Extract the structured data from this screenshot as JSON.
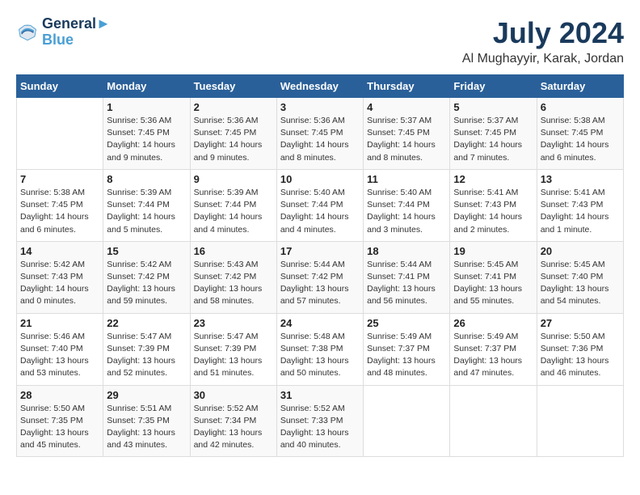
{
  "header": {
    "logo_line1": "General",
    "logo_line2": "Blue",
    "month": "July 2024",
    "location": "Al Mughayyir, Karak, Jordan"
  },
  "columns": [
    "Sunday",
    "Monday",
    "Tuesday",
    "Wednesday",
    "Thursday",
    "Friday",
    "Saturday"
  ],
  "weeks": [
    {
      "cells": [
        {
          "day": "",
          "info": ""
        },
        {
          "day": "1",
          "info": "Sunrise: 5:36 AM\nSunset: 7:45 PM\nDaylight: 14 hours\nand 9 minutes."
        },
        {
          "day": "2",
          "info": "Sunrise: 5:36 AM\nSunset: 7:45 PM\nDaylight: 14 hours\nand 9 minutes."
        },
        {
          "day": "3",
          "info": "Sunrise: 5:36 AM\nSunset: 7:45 PM\nDaylight: 14 hours\nand 8 minutes."
        },
        {
          "day": "4",
          "info": "Sunrise: 5:37 AM\nSunset: 7:45 PM\nDaylight: 14 hours\nand 8 minutes."
        },
        {
          "day": "5",
          "info": "Sunrise: 5:37 AM\nSunset: 7:45 PM\nDaylight: 14 hours\nand 7 minutes."
        },
        {
          "day": "6",
          "info": "Sunrise: 5:38 AM\nSunset: 7:45 PM\nDaylight: 14 hours\nand 6 minutes."
        }
      ]
    },
    {
      "cells": [
        {
          "day": "7",
          "info": "Sunrise: 5:38 AM\nSunset: 7:45 PM\nDaylight: 14 hours\nand 6 minutes."
        },
        {
          "day": "8",
          "info": "Sunrise: 5:39 AM\nSunset: 7:44 PM\nDaylight: 14 hours\nand 5 minutes."
        },
        {
          "day": "9",
          "info": "Sunrise: 5:39 AM\nSunset: 7:44 PM\nDaylight: 14 hours\nand 4 minutes."
        },
        {
          "day": "10",
          "info": "Sunrise: 5:40 AM\nSunset: 7:44 PM\nDaylight: 14 hours\nand 4 minutes."
        },
        {
          "day": "11",
          "info": "Sunrise: 5:40 AM\nSunset: 7:44 PM\nDaylight: 14 hours\nand 3 minutes."
        },
        {
          "day": "12",
          "info": "Sunrise: 5:41 AM\nSunset: 7:43 PM\nDaylight: 14 hours\nand 2 minutes."
        },
        {
          "day": "13",
          "info": "Sunrise: 5:41 AM\nSunset: 7:43 PM\nDaylight: 14 hours\nand 1 minute."
        }
      ]
    },
    {
      "cells": [
        {
          "day": "14",
          "info": "Sunrise: 5:42 AM\nSunset: 7:43 PM\nDaylight: 14 hours\nand 0 minutes."
        },
        {
          "day": "15",
          "info": "Sunrise: 5:42 AM\nSunset: 7:42 PM\nDaylight: 13 hours\nand 59 minutes."
        },
        {
          "day": "16",
          "info": "Sunrise: 5:43 AM\nSunset: 7:42 PM\nDaylight: 13 hours\nand 58 minutes."
        },
        {
          "day": "17",
          "info": "Sunrise: 5:44 AM\nSunset: 7:42 PM\nDaylight: 13 hours\nand 57 minutes."
        },
        {
          "day": "18",
          "info": "Sunrise: 5:44 AM\nSunset: 7:41 PM\nDaylight: 13 hours\nand 56 minutes."
        },
        {
          "day": "19",
          "info": "Sunrise: 5:45 AM\nSunset: 7:41 PM\nDaylight: 13 hours\nand 55 minutes."
        },
        {
          "day": "20",
          "info": "Sunrise: 5:45 AM\nSunset: 7:40 PM\nDaylight: 13 hours\nand 54 minutes."
        }
      ]
    },
    {
      "cells": [
        {
          "day": "21",
          "info": "Sunrise: 5:46 AM\nSunset: 7:40 PM\nDaylight: 13 hours\nand 53 minutes."
        },
        {
          "day": "22",
          "info": "Sunrise: 5:47 AM\nSunset: 7:39 PM\nDaylight: 13 hours\nand 52 minutes."
        },
        {
          "day": "23",
          "info": "Sunrise: 5:47 AM\nSunset: 7:39 PM\nDaylight: 13 hours\nand 51 minutes."
        },
        {
          "day": "24",
          "info": "Sunrise: 5:48 AM\nSunset: 7:38 PM\nDaylight: 13 hours\nand 50 minutes."
        },
        {
          "day": "25",
          "info": "Sunrise: 5:49 AM\nSunset: 7:37 PM\nDaylight: 13 hours\nand 48 minutes."
        },
        {
          "day": "26",
          "info": "Sunrise: 5:49 AM\nSunset: 7:37 PM\nDaylight: 13 hours\nand 47 minutes."
        },
        {
          "day": "27",
          "info": "Sunrise: 5:50 AM\nSunset: 7:36 PM\nDaylight: 13 hours\nand 46 minutes."
        }
      ]
    },
    {
      "cells": [
        {
          "day": "28",
          "info": "Sunrise: 5:50 AM\nSunset: 7:35 PM\nDaylight: 13 hours\nand 45 minutes."
        },
        {
          "day": "29",
          "info": "Sunrise: 5:51 AM\nSunset: 7:35 PM\nDaylight: 13 hours\nand 43 minutes."
        },
        {
          "day": "30",
          "info": "Sunrise: 5:52 AM\nSunset: 7:34 PM\nDaylight: 13 hours\nand 42 minutes."
        },
        {
          "day": "31",
          "info": "Sunrise: 5:52 AM\nSunset: 7:33 PM\nDaylight: 13 hours\nand 40 minutes."
        },
        {
          "day": "",
          "info": ""
        },
        {
          "day": "",
          "info": ""
        },
        {
          "day": "",
          "info": ""
        }
      ]
    }
  ]
}
